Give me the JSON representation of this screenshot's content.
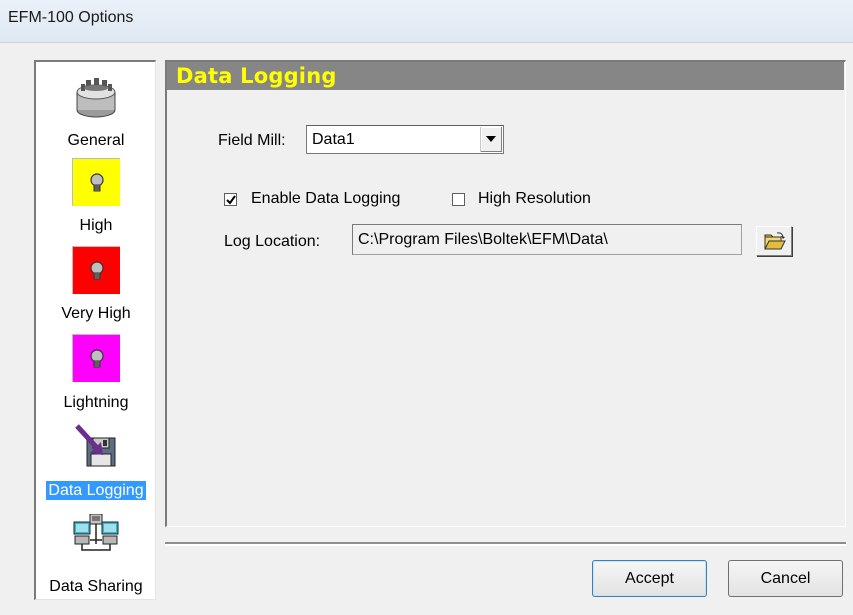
{
  "window": {
    "title": "EFM-100 Options"
  },
  "sidebar": {
    "items": [
      {
        "label": "General",
        "icon": "field-mill-device-icon"
      },
      {
        "label": "High",
        "icon": "bulb-icon",
        "color": "#ffff00"
      },
      {
        "label": "Very High",
        "icon": "bulb-icon",
        "color": "#ff0000"
      },
      {
        "label": "Lightning",
        "icon": "bulb-icon",
        "color": "#ff00ff"
      },
      {
        "label": "Data Logging",
        "icon": "floppy-disk-arrow-icon",
        "selected": true
      },
      {
        "label": "Data Sharing",
        "icon": "network-computers-icon"
      }
    ]
  },
  "panel": {
    "header": "Data Logging",
    "header_color": "#ffff00",
    "field_mill": {
      "label": "Field Mill:",
      "value": "Data1"
    },
    "enable_logging": {
      "label": "Enable Data Logging",
      "checked": true
    },
    "high_resolution": {
      "label": "High Resolution",
      "checked": false
    },
    "log_location": {
      "label": "Log Location:",
      "value": "C:\\Program Files\\Boltek\\EFM\\Data\\"
    }
  },
  "buttons": {
    "accept": "Accept",
    "cancel": "Cancel"
  },
  "colors": {
    "selection": "#3399ff",
    "header_bg": "#868686"
  }
}
